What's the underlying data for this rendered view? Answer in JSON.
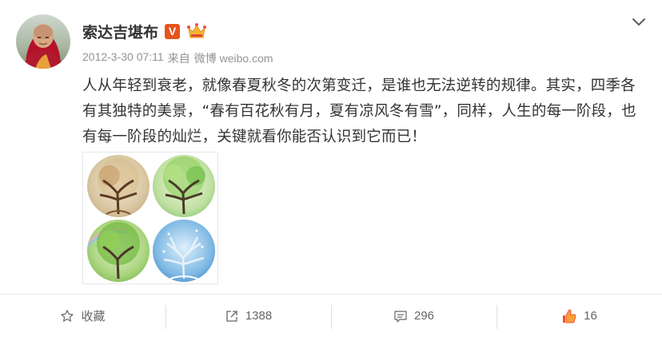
{
  "post": {
    "user_name": "索达吉堪布",
    "verified_badge": "V",
    "timestamp": "2012-3-30 07:11",
    "source_prefix": "来自",
    "source": "微博 weibo.com",
    "content": "人从年轻到衰老，就像春夏秋冬的次第变迁，是谁也无法逆转的规律。其实，四季各有其独特的美景，“春有百花秋有月，夏有凉风冬有雪”，同样，人生的每一阶段，也有每一阶段的灿烂，关键就看你能否认识到它而已！",
    "icons": {
      "menu": "chevron-down-icon",
      "badge": "verified-v-icon",
      "vip": "crown-icon"
    },
    "colors": {
      "verified": "#e6551b",
      "like": "#f04e3e",
      "text": "#333333",
      "meta": "#939393"
    }
  },
  "actions": {
    "favorite_label": "收藏",
    "repost_count": "1388",
    "comment_count": "296",
    "like_count": "16"
  }
}
